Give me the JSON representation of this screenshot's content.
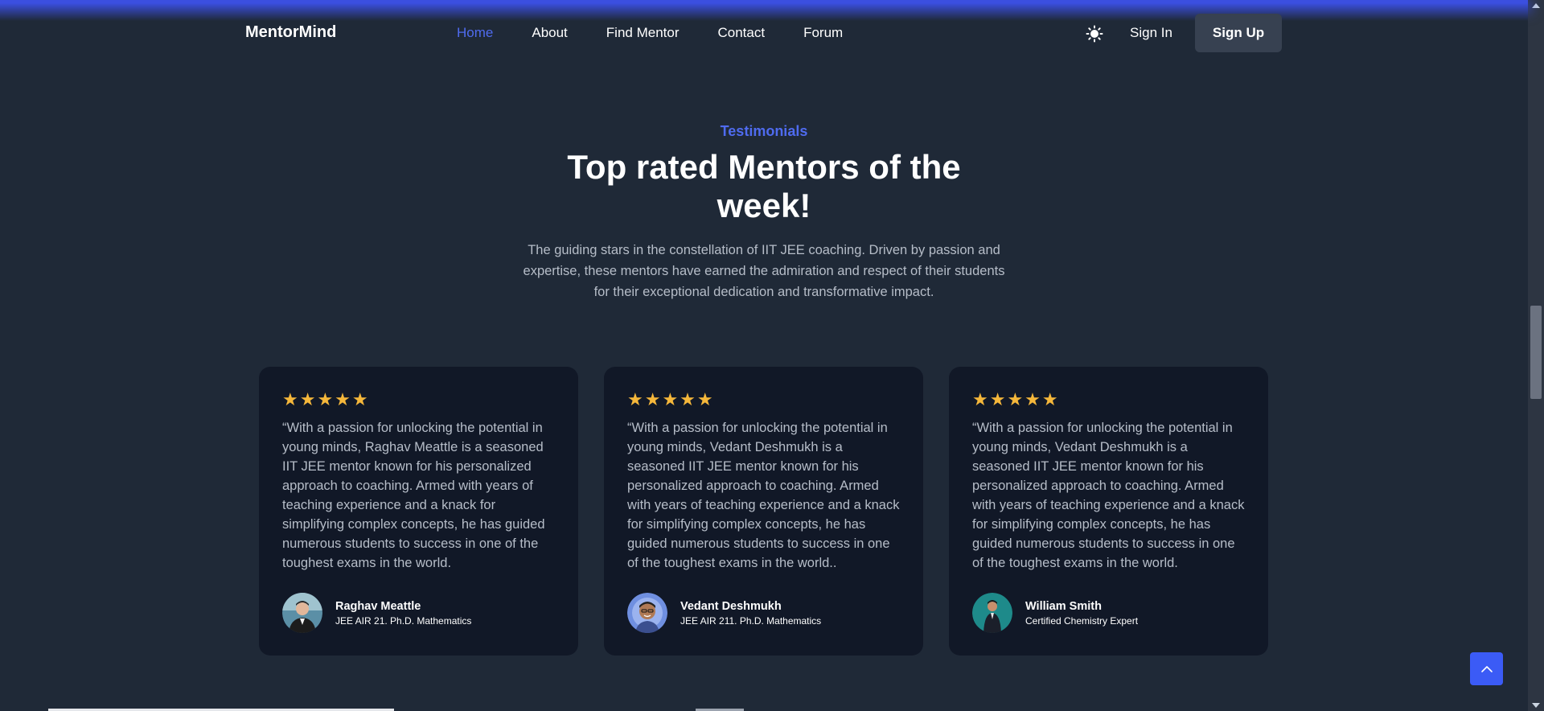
{
  "app": {
    "brand": "MentorMind"
  },
  "nav": {
    "links": [
      {
        "label": "Home",
        "active": true
      },
      {
        "label": "About",
        "active": false
      },
      {
        "label": "Find Mentor",
        "active": false
      },
      {
        "label": "Contact",
        "active": false
      },
      {
        "label": "Forum",
        "active": false
      }
    ],
    "theme_icon": "sun-icon",
    "sign_in": "Sign In",
    "sign_up": "Sign Up"
  },
  "section": {
    "eyebrow": "Testimonials",
    "title": "Top rated Mentors of the week!",
    "description": "The guiding stars in the constellation of IIT JEE coaching. Driven by passion and expertise, these mentors have earned the admiration and respect of their students for their exceptional dedication and transformative impact."
  },
  "testimonials": [
    {
      "rating": 5,
      "stars": "★★★★★",
      "quote": "“With a passion for unlocking the potential in young minds, Raghav Meattle is a seasoned IIT JEE mentor known for his personalized approach to coaching. Armed with years of teaching experience and a knack for simplifying complex concepts, he has guided numerous students to success in one of the toughest exams in the world.",
      "name": "Raghav Meattle",
      "title": "JEE AIR 21. Ph.D. Mathematics"
    },
    {
      "rating": 5,
      "stars": "★★★★★",
      "quote": "“With a passion for unlocking the potential in young minds, Vedant Deshmukh is a seasoned IIT JEE mentor known for his personalized approach to coaching. Armed with years of teaching experience and a knack for simplifying complex concepts, he has guided numerous students to success in one of the toughest exams in the world..",
      "name": "Vedant Deshmukh",
      "title": "JEE AIR 211. Ph.D. Mathematics"
    },
    {
      "rating": 5,
      "stars": "★★★★★",
      "quote": "“With a passion for unlocking the potential in young minds, Vedant Deshmukh is a seasoned IIT JEE mentor known for his personalized approach to coaching. Armed with years of teaching experience and a knack for simplifying complex concepts, he has guided numerous students to success in one of the toughest exams in the world.",
      "name": "William Smith",
      "title": "Certified Chemistry Expert"
    }
  ],
  "colors": {
    "background": "#1f2937",
    "card": "#111827",
    "accent": "#4f6bef",
    "star": "#f5b73b",
    "muted_text": "#b6bdc8"
  },
  "back_to_top_icon": "chevron-up-icon"
}
